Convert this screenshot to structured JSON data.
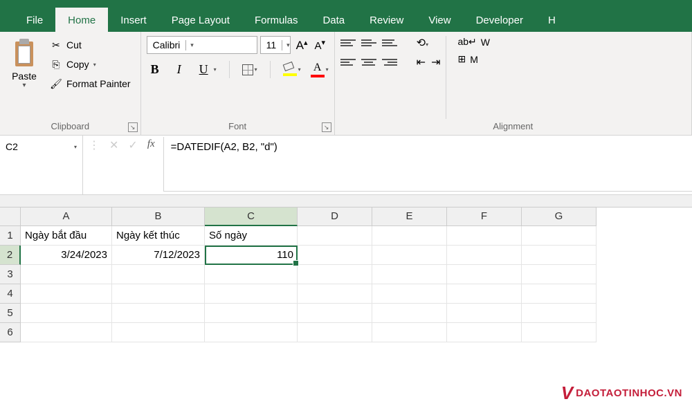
{
  "tabs": {
    "file": "File",
    "home": "Home",
    "insert": "Insert",
    "page_layout": "Page Layout",
    "formulas": "Formulas",
    "data": "Data",
    "review": "Review",
    "view": "View",
    "developer": "Developer",
    "help": "H"
  },
  "ribbon": {
    "clipboard": {
      "label": "Clipboard",
      "paste": "Paste",
      "cut": "Cut",
      "copy": "Copy",
      "format_painter": "Format Painter"
    },
    "font": {
      "label": "Font",
      "name": "Calibri",
      "size": "11",
      "bold": "B",
      "italic": "I",
      "underline": "U",
      "grow": "A",
      "shrink": "A",
      "font_color_letter": "A"
    },
    "alignment": {
      "label": "Alignment",
      "wrap": "W",
      "merge": "M"
    }
  },
  "namebox": "C2",
  "formula": "=DATEDIF(A2, B2, \"d\")",
  "columns": [
    "A",
    "B",
    "C",
    "D",
    "E",
    "F",
    "G"
  ],
  "rows": [
    "1",
    "2",
    "3",
    "4",
    "5",
    "6"
  ],
  "cells": {
    "a1": "Ngày bắt đầu",
    "b1": "Ngày kết thúc",
    "c1": "Số ngày",
    "a2": "3/24/2023",
    "b2": "7/12/2023",
    "c2": "110"
  },
  "watermark": {
    "logo": "V",
    "text": "DAOTAOTINHOC.VN"
  }
}
